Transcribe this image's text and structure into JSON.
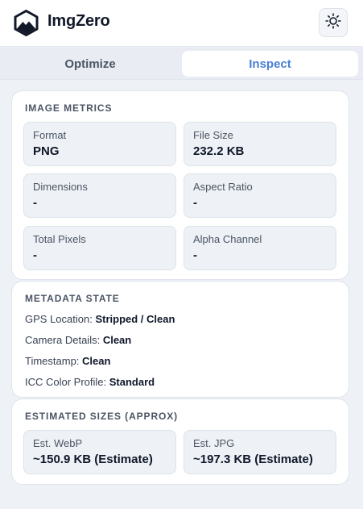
{
  "app": {
    "title": "ImgZero"
  },
  "tabs": [
    {
      "label": "Optimize",
      "active": false
    },
    {
      "label": "Inspect",
      "active": true
    }
  ],
  "icons": {
    "logo": "mountain-logo-icon",
    "theme": "sun-icon"
  },
  "colors": {
    "accent": "#4a7fd6",
    "page_bg": "#eef1f6",
    "tile_bg": "#eef1f5"
  },
  "image_metrics": {
    "title": "IMAGE METRICS",
    "items": [
      {
        "label": "Format",
        "value": "PNG"
      },
      {
        "label": "File Size",
        "value": "232.2 KB"
      },
      {
        "label": "Dimensions",
        "value": "-"
      },
      {
        "label": "Aspect Ratio",
        "value": "-"
      },
      {
        "label": "Total Pixels",
        "value": "-"
      },
      {
        "label": "Alpha Channel",
        "value": "-"
      }
    ]
  },
  "metadata_state": {
    "title": "METADATA STATE",
    "rows": [
      {
        "label": "GPS Location:",
        "value": "Stripped / Clean"
      },
      {
        "label": "Camera Details:",
        "value": "Clean"
      },
      {
        "label": "Timestamp:",
        "value": "Clean"
      },
      {
        "label": "ICC Color Profile:",
        "value": "Standard"
      }
    ]
  },
  "estimated_sizes": {
    "title": "ESTIMATED SIZES (APPROX)",
    "items": [
      {
        "label": "Est. WebP",
        "value": "~150.9 KB (Estimate)"
      },
      {
        "label": "Est. JPG",
        "value": "~197.3 KB (Estimate)"
      }
    ]
  }
}
